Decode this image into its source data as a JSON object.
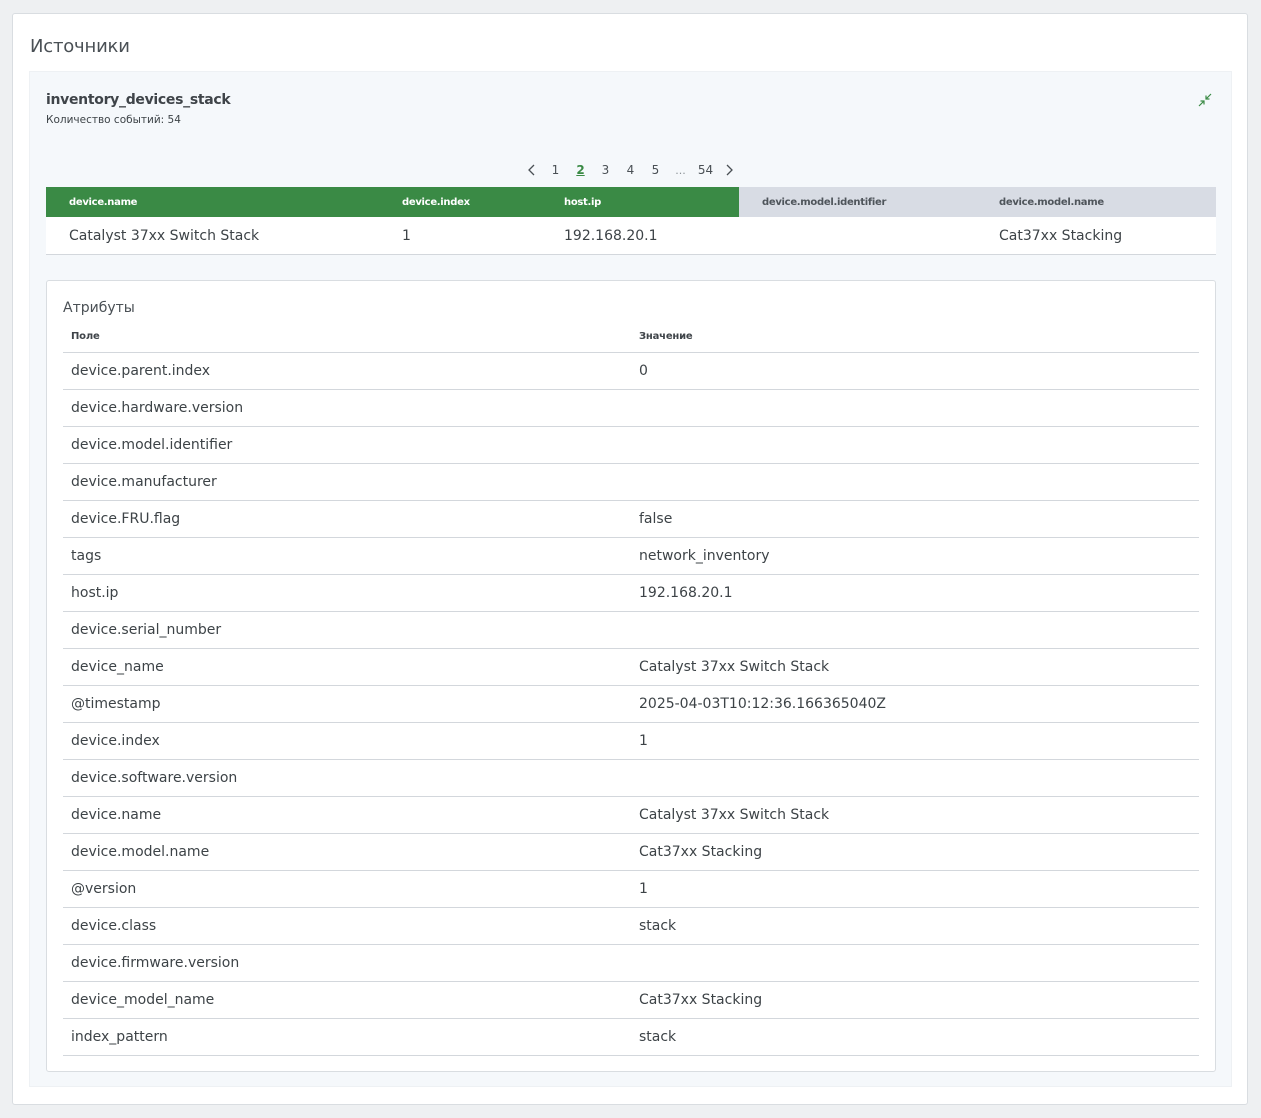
{
  "page": {
    "title": "Источники"
  },
  "source": {
    "title": "inventory_devices_stack",
    "count_label": "Количество событий: 54"
  },
  "pagination": {
    "pages": [
      "1",
      "2",
      "3",
      "4",
      "5",
      "...",
      "54"
    ],
    "current": "2"
  },
  "grid": {
    "columns": [
      "device.name",
      "device.index",
      "host.ip",
      "device.model.identifier",
      "device.model.name"
    ],
    "row": [
      "Catalyst 37xx Switch Stack",
      "1",
      "192.168.20.1",
      "",
      "Cat37xx Stacking"
    ]
  },
  "attributes": {
    "title": "Атрибуты",
    "col_field": "Поле",
    "col_value": "Значение",
    "rows": [
      {
        "field": "device.parent.index",
        "value": "0"
      },
      {
        "field": "device.hardware.version",
        "value": ""
      },
      {
        "field": "device.model.identifier",
        "value": ""
      },
      {
        "field": "device.manufacturer",
        "value": ""
      },
      {
        "field": "device.FRU.flag",
        "value": "false"
      },
      {
        "field": "tags",
        "value": "network_inventory"
      },
      {
        "field": "host.ip",
        "value": "192.168.20.1"
      },
      {
        "field": "device.serial_number",
        "value": ""
      },
      {
        "field": "device_name",
        "value": "Catalyst 37xx Switch Stack"
      },
      {
        "field": "@timestamp",
        "value": "2025-04-03T10:12:36.166365040Z"
      },
      {
        "field": "device.index",
        "value": "1"
      },
      {
        "field": "device.software.version",
        "value": ""
      },
      {
        "field": "device.name",
        "value": "Catalyst 37xx Switch Stack"
      },
      {
        "field": "device.model.name",
        "value": "Cat37xx Stacking"
      },
      {
        "field": "@version",
        "value": "1"
      },
      {
        "field": "device.class",
        "value": "stack"
      },
      {
        "field": "device.firmware.version",
        "value": ""
      },
      {
        "field": "device_model_name",
        "value": "Cat37xx Stacking"
      },
      {
        "field": "index_pattern",
        "value": "stack"
      }
    ]
  },
  "icons": {
    "collapse": "collapse-icon",
    "prev": "chevron-left-icon",
    "next": "chevron-right-icon"
  },
  "colors": {
    "accent": "#3a8a45",
    "header_grey": "#d8dce4"
  }
}
